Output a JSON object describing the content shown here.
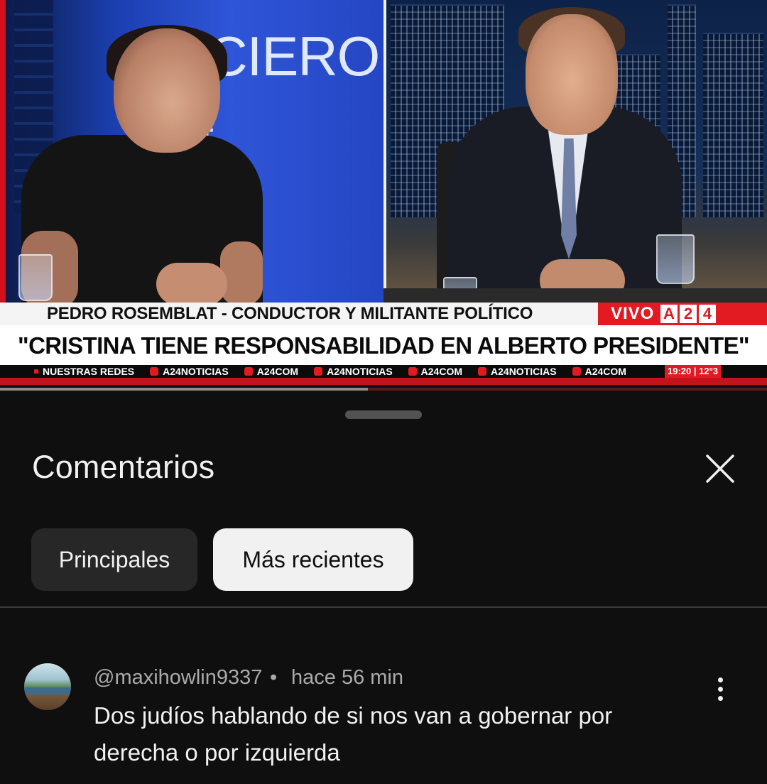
{
  "video": {
    "name_caption": "PEDRO ROSEMBLAT - CONDUCTOR Y MILITANTE POLÍTICO",
    "live_label": "VIVO",
    "channel_logo": [
      "A",
      "2",
      "4"
    ],
    "headline": "\"CRISTINA TIENE RESPONSABILIDAD EN ALBERTO PRESIDENTE\"",
    "studio_wall_text": "TICIERO",
    "studio_wall_text2": "4",
    "ticker": [
      {
        "label": "NUESTRAS REDES",
        "icon": "square-dot-icon"
      },
      {
        "label": "A24NOTICIAS",
        "icon": "instagram-icon"
      },
      {
        "label": "A24COM",
        "icon": "x-icon"
      },
      {
        "label": "A24NOTICIAS",
        "icon": "tiktok-icon"
      },
      {
        "label": "A24COM",
        "icon": "facebook-icon"
      },
      {
        "label": "A24NOTICIAS",
        "icon": "telegram-icon"
      },
      {
        "label": "A24COM",
        "icon": "youtube-icon"
      }
    ],
    "clock": "19:20 | 12°3",
    "buffer_fraction": 0.48,
    "colors": {
      "brand_red": "#e21a22"
    }
  },
  "comments": {
    "title": "Comentarios",
    "close_icon": "close-icon",
    "filters": [
      {
        "label": "Principales",
        "selected": false
      },
      {
        "label": "Más recientes",
        "selected": true
      }
    ],
    "items": [
      {
        "author": "@maxihowlin9337",
        "separator": "•",
        "time": "hace 56 min",
        "text": "Dos judíos hablando de si nos van a gobernar por derecha o por izquierda",
        "menu_icon": "more-vert-icon"
      }
    ]
  }
}
